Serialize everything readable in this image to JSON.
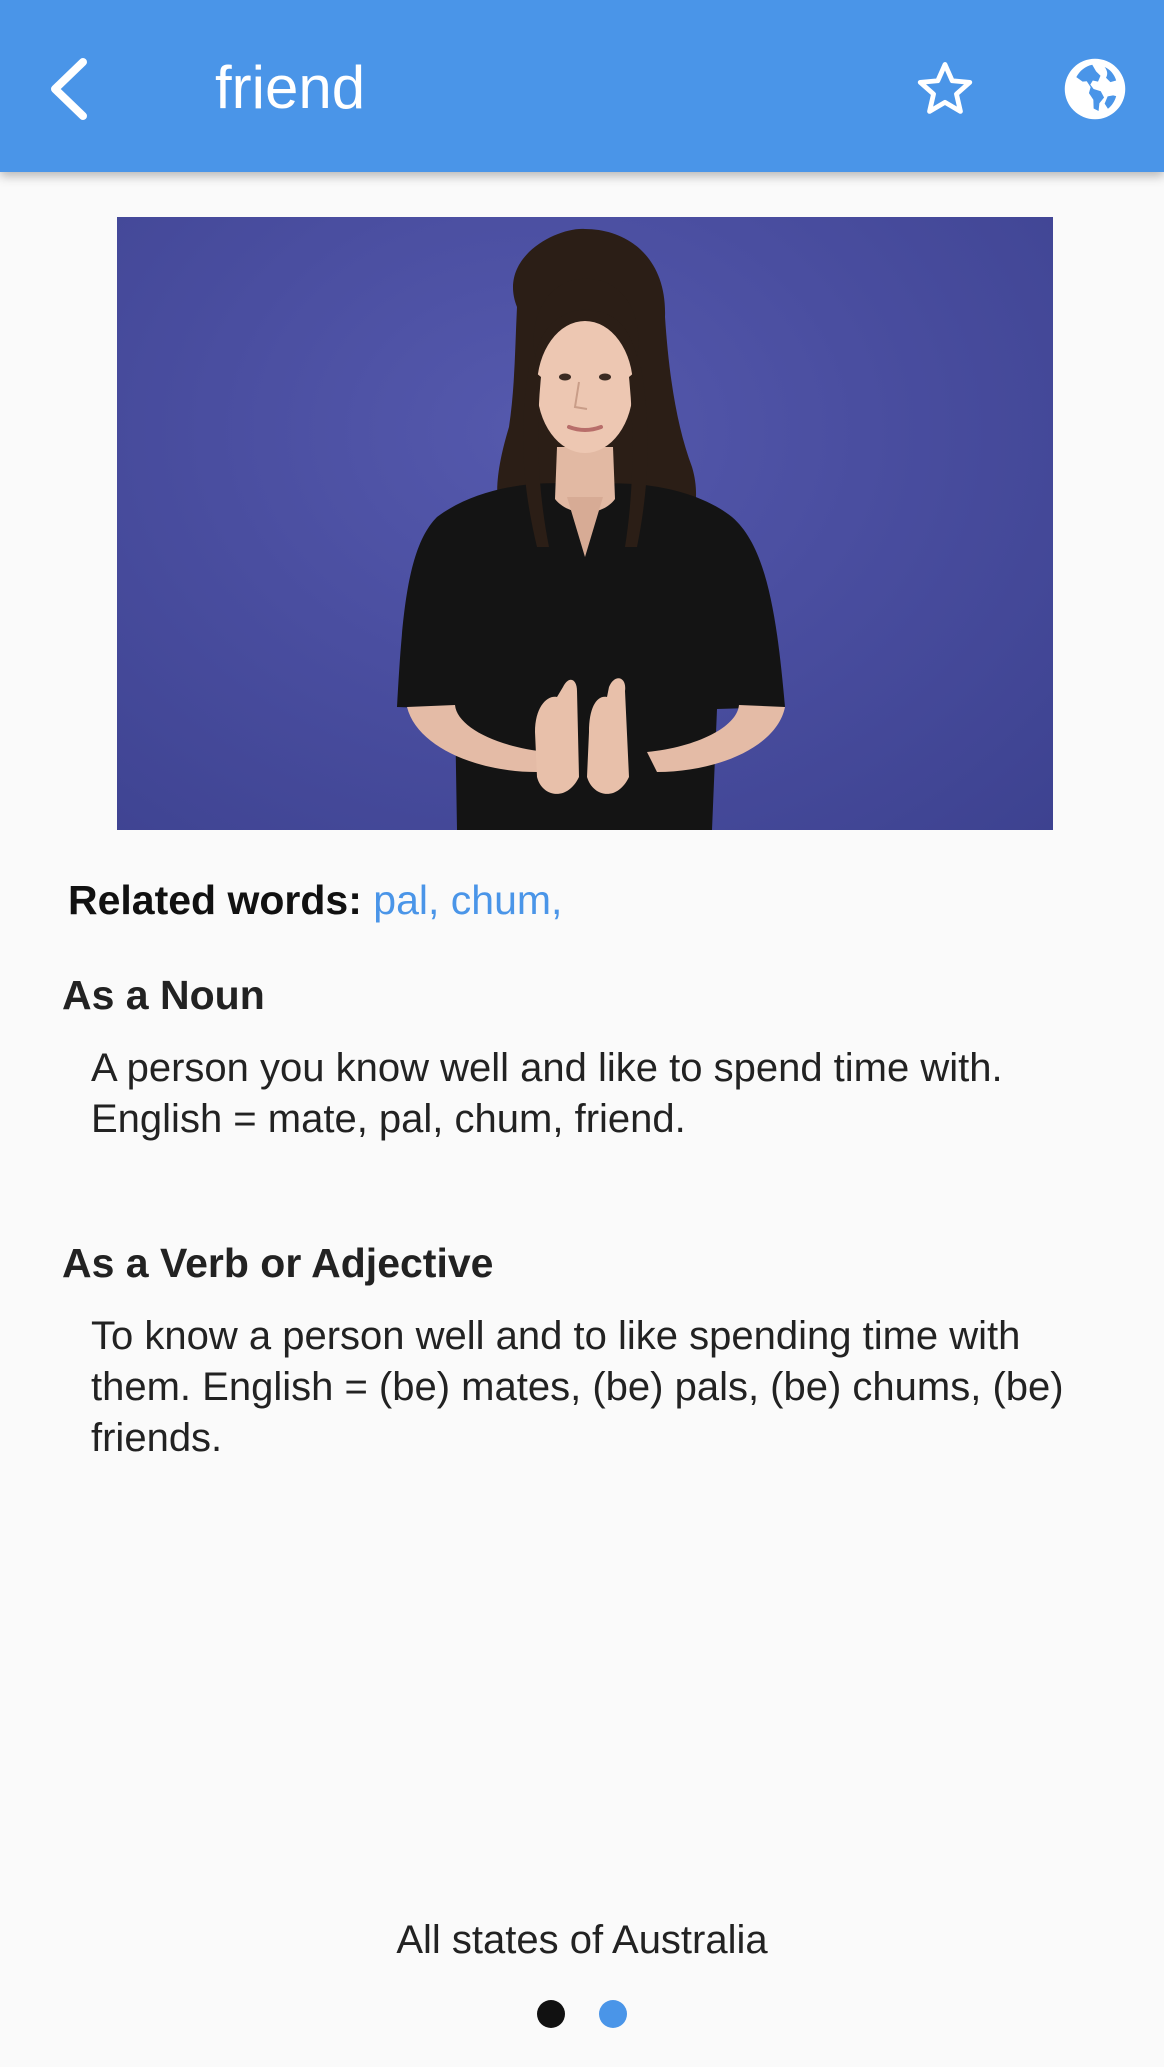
{
  "app_bar": {
    "title": "friend",
    "back_icon": "chevron-left-icon",
    "favorite_icon": "star-outline-icon",
    "region_icon": "globe-icon",
    "background_color": "#4a95e8"
  },
  "video": {
    "description_icon": "sign-video-player"
  },
  "related": {
    "label": "Related words:",
    "words": "pal, chum,",
    "link_color": "#4a95e8"
  },
  "sections": [
    {
      "heading": "As a Noun",
      "body": "A person you know well and like to spend time with. English = mate, pal, chum, friend."
    },
    {
      "heading": "As a Verb or Adjective",
      "body": "To know a person well and to like spending time with them. English = (be) mates, (be) pals, (be) chums, (be) friends."
    }
  ],
  "footer": {
    "region_text": "All states of Australia",
    "page_dots": [
      {
        "color": "#111111",
        "active": false
      },
      {
        "color": "#4a95e8",
        "active": true
      }
    ]
  }
}
